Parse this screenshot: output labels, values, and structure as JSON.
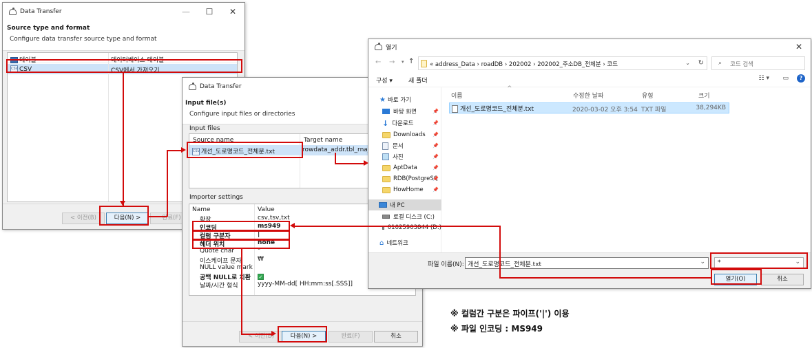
{
  "win1": {
    "title": "Data Transfer",
    "controls": {
      "min": "—",
      "max": "☐",
      "close": "✕"
    },
    "header_title": "Source type and format",
    "header_subtitle": "Configure data transfer source type and format",
    "rows": [
      {
        "name": "테이블",
        "desc": "데이터베이스 테이블"
      },
      {
        "name": "CSV",
        "desc": "CSV에서 가져오기"
      }
    ],
    "buttons": {
      "prev": "< 이전(B)",
      "next": "다음(N) >",
      "finish": "완료(F)"
    }
  },
  "win2": {
    "title": "Data Transfer",
    "header_title": "Input file(s)",
    "header_subtitle": "Configure input files or directories",
    "input_files_label": "Input files",
    "columns": {
      "source": "Source name",
      "target": "Target name"
    },
    "file_row": {
      "source": "개선_도로명코드_전체분.txt",
      "target": "rowdata_addr.tbl_rna_a"
    },
    "importer_label": "Importer settings",
    "settings_columns": {
      "name": "Name",
      "value": "Value"
    },
    "settings": [
      {
        "name": "확장",
        "value": "csv,tsv,txt"
      },
      {
        "name": "인코딩",
        "value": "ms949"
      },
      {
        "name": "컬럼 구분자",
        "value": "|"
      },
      {
        "name": "헤더 위치",
        "value": "none"
      },
      {
        "name": "Quote char",
        "value": "\""
      },
      {
        "name": "이스케이프 문자",
        "value": "₩"
      },
      {
        "name": "NULL value mark",
        "value": ""
      },
      {
        "name": "공백 NULL로 치환",
        "value": "✓"
      },
      {
        "name": "날짜/시간 형식",
        "value": "yyyy-MM-dd[ HH:mm:ss[.SSS]]"
      }
    ],
    "buttons": {
      "prev": "< 이전(B)",
      "next": "다음(N) >",
      "finish": "완료(F)",
      "cancel": "취소"
    }
  },
  "win3": {
    "title": "열기",
    "close": "✕",
    "nav": {
      "back": "←",
      "forward": "→",
      "up": "↑"
    },
    "breadcrumb": "« address_Data  ›  roadDB  ›  202002  ›  202002_주소DB_전체분  ›  코드",
    "search_placeholder": "코드 검색",
    "toolbar": {
      "organize": "구성 ▾",
      "new_folder": "새 폴더"
    },
    "sidebar": [
      {
        "label": "바로 가기",
        "kind": "star",
        "pinned": false
      },
      {
        "label": "바탕 화면",
        "kind": "desktop",
        "pinned": true
      },
      {
        "label": "다운로드",
        "kind": "download",
        "pinned": true
      },
      {
        "label": "Downloads",
        "kind": "folder",
        "pinned": true
      },
      {
        "label": "문서",
        "kind": "doc",
        "pinned": true
      },
      {
        "label": "사진",
        "kind": "pic",
        "pinned": true
      },
      {
        "label": "AptData",
        "kind": "folder",
        "pinned": true
      },
      {
        "label": "RDB(PostgreSQL",
        "kind": "folder",
        "pinned": true
      },
      {
        "label": "HowHome",
        "kind": "folder",
        "pinned": true
      },
      {
        "label": "내 PC",
        "kind": "pc",
        "pinned": false
      },
      {
        "label": "로컬 디스크 (C:)",
        "kind": "disk",
        "pinned": false
      },
      {
        "label": "01025903844 (D:)",
        "kind": "disk",
        "pinned": false
      },
      {
        "label": "네트워크",
        "kind": "net",
        "pinned": false
      }
    ],
    "columns": {
      "name": "이름",
      "modified": "수정한 날짜",
      "type": "유형",
      "size": "크기"
    },
    "files": [
      {
        "name": "개선_도로명코드_전체분.txt",
        "modified": "2020-03-02 오후 3:54",
        "type": "TXT 파일",
        "size": "38,294KB"
      }
    ],
    "filename_label": "파일 이름(N):",
    "filename_value": "개선_도로명코드_전체분.txt",
    "filter_value": "*",
    "open_button": "열기(O)",
    "cancel_button": "취소"
  },
  "notes": [
    "※ 컬럼간 구분은 파이프('|') 이용",
    "※ 파일 인코딩 : MS949"
  ],
  "colors": {
    "highlight": "#d20b0b",
    "selection": "#cce8ff"
  }
}
